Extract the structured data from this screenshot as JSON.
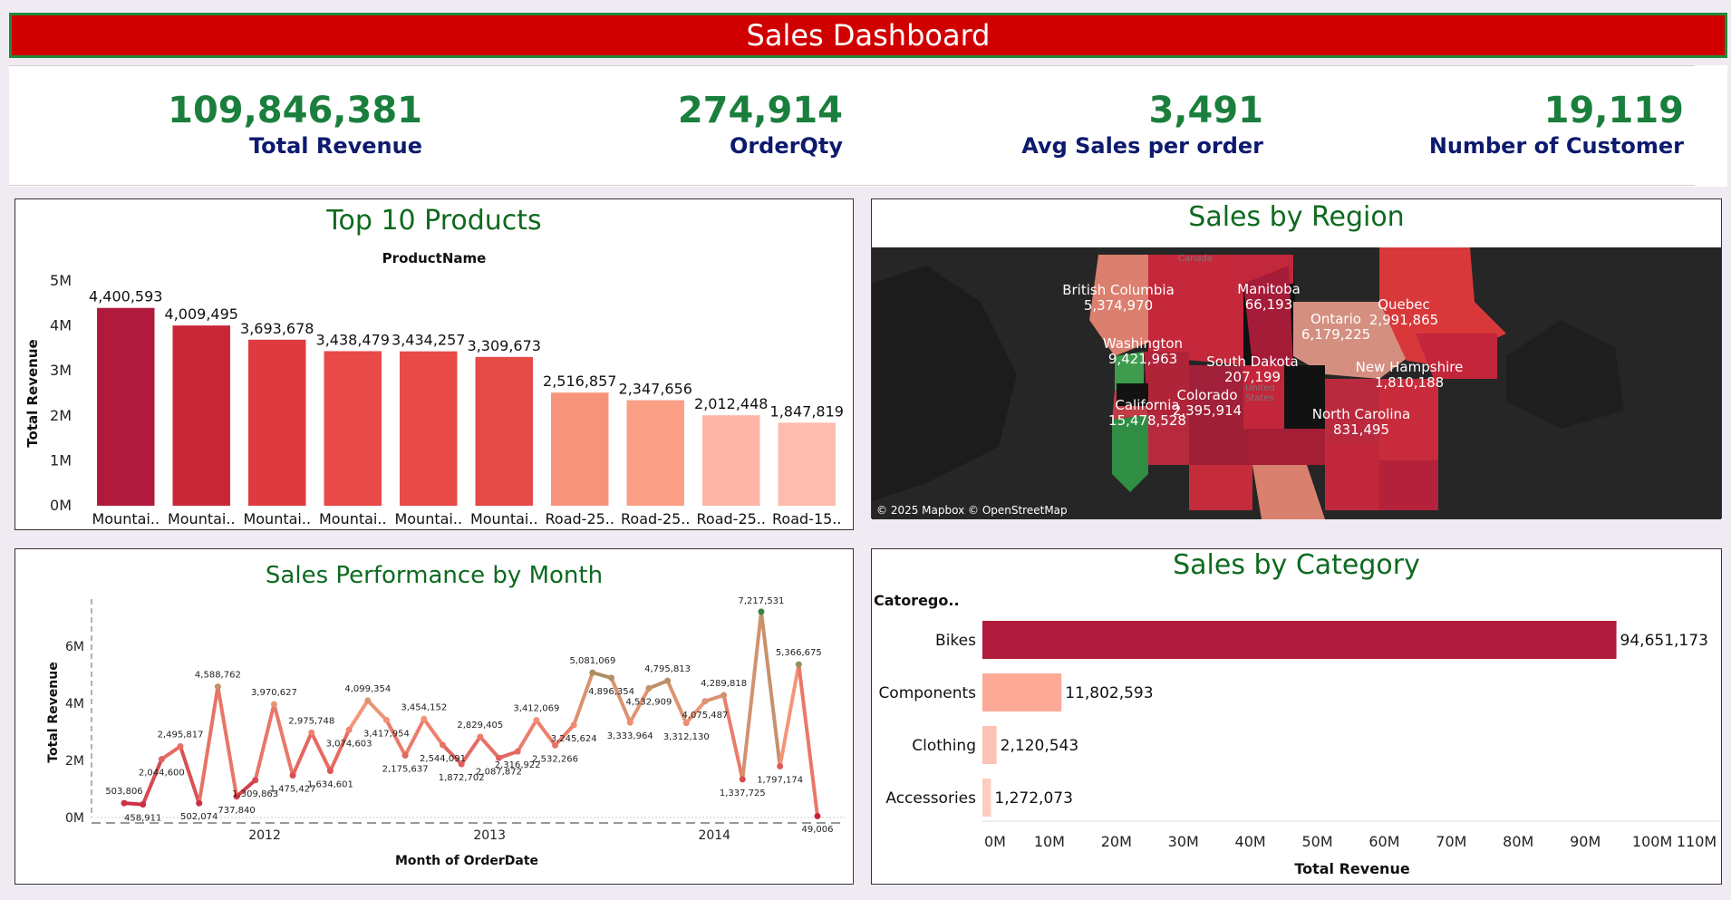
{
  "header": {
    "title": "Sales Dashboard"
  },
  "kpis": [
    {
      "value": "109,846,381",
      "label": "Total Revenue"
    },
    {
      "value": "274,914",
      "label": "OrderQty"
    },
    {
      "value": "3,491",
      "label": "Avg Sales per order"
    },
    {
      "value": "19,119",
      "label": "Number of Customer"
    }
  ],
  "colors": {
    "title_bg": "#d10000",
    "title_border": "#1f8a3a",
    "kpi_value": "#1a7f3c",
    "kpi_label": "#0d1a6e",
    "panel_title": "#0e6a1f"
  },
  "top_products": {
    "title": "Top 10 Products"
  },
  "region": {
    "title": "Sales by Region",
    "attribution": "© 2025 Mapbox © OpenStreetMap",
    "faint_labels": [
      "Canada",
      "United",
      "States"
    ],
    "labels": [
      {
        "name": "British Columbia",
        "value": "5,374,970"
      },
      {
        "name": "Manitoba",
        "value": "66,193"
      },
      {
        "name": "Quebec",
        "value": "2,991,865"
      },
      {
        "name": "Ontario",
        "value": "6,179,225"
      },
      {
        "name": "Washington",
        "value": "9,421,963"
      },
      {
        "name": "South Dakota",
        "value": "207,199"
      },
      {
        "name": "New Hampshire",
        "value": "1,810,188"
      },
      {
        "name": "Colorado",
        "value": "2,395,914"
      },
      {
        "name": "California",
        "value": "15,478,528"
      },
      {
        "name": "North Carolina",
        "value": "831,495"
      }
    ]
  },
  "monthly": {
    "title": "Sales Performance by Month"
  },
  "category": {
    "title": "Sales by Category"
  },
  "chart_data": [
    {
      "type": "bar",
      "title": "Top 10 Products",
      "subtitle": "ProductName",
      "ylabel": "Total Revenue",
      "xlabel": "",
      "ylim": [
        0,
        5000000
      ],
      "yticks": [
        "0M",
        "1M",
        "2M",
        "3M",
        "4M",
        "5M"
      ],
      "categories": [
        "Mountai..",
        "Mountai..",
        "Mountai..",
        "Mountai..",
        "Mountai..",
        "Mountai..",
        "Road-25..",
        "Road-25..",
        "Road-25..",
        "Road-15.."
      ],
      "values": [
        4400593,
        4009495,
        3693678,
        3438479,
        3434257,
        3309673,
        2516857,
        2347656,
        2012448,
        1847819
      ],
      "labels": [
        "4,400,593",
        "4,009,495",
        "3,693,678",
        "3,438,479",
        "3,434,257",
        "3,309,673",
        "2,516,857",
        "2,347,656",
        "2,012,448",
        "1,847,819"
      ],
      "colors": [
        "#b01a3c",
        "#c92638",
        "#df3a3f",
        "#e84a47",
        "#e84a47",
        "#e44a46",
        "#f8937b",
        "#fb9f86",
        "#fdb5a5",
        "#fdbdae"
      ]
    },
    {
      "type": "map",
      "title": "Sales by Region",
      "regions": [
        "British Columbia",
        "Manitoba",
        "Quebec",
        "Ontario",
        "Washington",
        "South Dakota",
        "New Hampshire",
        "Colorado",
        "California",
        "North Carolina"
      ],
      "values": [
        5374970,
        66193,
        2991865,
        6179225,
        9421963,
        207199,
        1810188,
        2395914,
        15478528,
        831495
      ]
    },
    {
      "type": "line",
      "title": "Sales Performance by Month",
      "xlabel": "Month of OrderDate",
      "ylabel": "Total Revenue",
      "ylim": [
        0,
        7500000
      ],
      "yticks": [
        "0M",
        "2M",
        "4M",
        "6M"
      ],
      "xticks": [
        "2012",
        "2013",
        "2014"
      ],
      "x": [
        "2011-05",
        "2011-06",
        "2011-07",
        "2011-08",
        "2011-09",
        "2011-10",
        "2011-11",
        "2011-12",
        "2012-01",
        "2012-02",
        "2012-03",
        "2012-04",
        "2012-05",
        "2012-06",
        "2012-07",
        "2012-08",
        "2012-09",
        "2012-10",
        "2012-11",
        "2012-12",
        "2013-01",
        "2013-02",
        "2013-03",
        "2013-04",
        "2013-05",
        "2013-06",
        "2013-07",
        "2013-08",
        "2013-09",
        "2013-10",
        "2013-11",
        "2013-12",
        "2014-01",
        "2014-02",
        "2014-03",
        "2014-04",
        "2014-05",
        "2014-06"
      ],
      "values": [
        503806,
        458911,
        2044600,
        2495817,
        502074,
        4588762,
        737840,
        1309863,
        3970627,
        1475427,
        2975748,
        1634601,
        3074603,
        4099354,
        3417954,
        2175637,
        3454152,
        2544091,
        1872702,
        2829405,
        2087872,
        2316922,
        3412069,
        2532266,
        3245624,
        5081069,
        4896354,
        3333964,
        4532909,
        4795813,
        3312130,
        4075487,
        4289818,
        1337725,
        7217531,
        1797174,
        5366675,
        49006
      ],
      "labels": [
        "503,806",
        "458,911",
        "2,044,600",
        "2,495,817",
        "502,074",
        "4,588,762",
        "737,840",
        "1,309,863",
        "3,970,627",
        "1,475,427",
        "2,975,748",
        "1,634,601",
        "3,074,603",
        "4,099,354",
        "3,417,954",
        "2,175,637",
        "3,454,152",
        "2,544,091",
        "1,872,702",
        "2,829,405",
        "2,087,872",
        "2,316,922",
        "3,412,069",
        "2,532,266",
        "3,245,624",
        "5,081,069",
        "4,896,354",
        "3,333,964",
        "4,532,909",
        "4,795,813",
        "3,312,130",
        "4,075,487",
        "4,289,818",
        "1,337,725",
        "7,217,531",
        "1,797,174",
        "5,366,675",
        "49,006"
      ]
    },
    {
      "type": "bar",
      "orientation": "horizontal",
      "title": "Sales by Category",
      "subtitle": "Catorego..",
      "xlabel": "Total Revenue",
      "ylabel": "",
      "xlim": [
        0,
        110000000
      ],
      "xticks": [
        "0M",
        "10M",
        "20M",
        "30M",
        "40M",
        "50M",
        "60M",
        "70M",
        "80M",
        "90M",
        "100M",
        "110M"
      ],
      "categories": [
        "Bikes",
        "Components",
        "Clothing",
        "Accessories"
      ],
      "values": [
        94651173,
        11802593,
        2120543,
        1272073
      ],
      "labels": [
        "94,651,173",
        "11,802,593",
        "2,120,543",
        "1,272,073"
      ],
      "colors": [
        "#b01a3c",
        "#fca998",
        "#fcc2b4",
        "#fdcdc0"
      ]
    }
  ]
}
